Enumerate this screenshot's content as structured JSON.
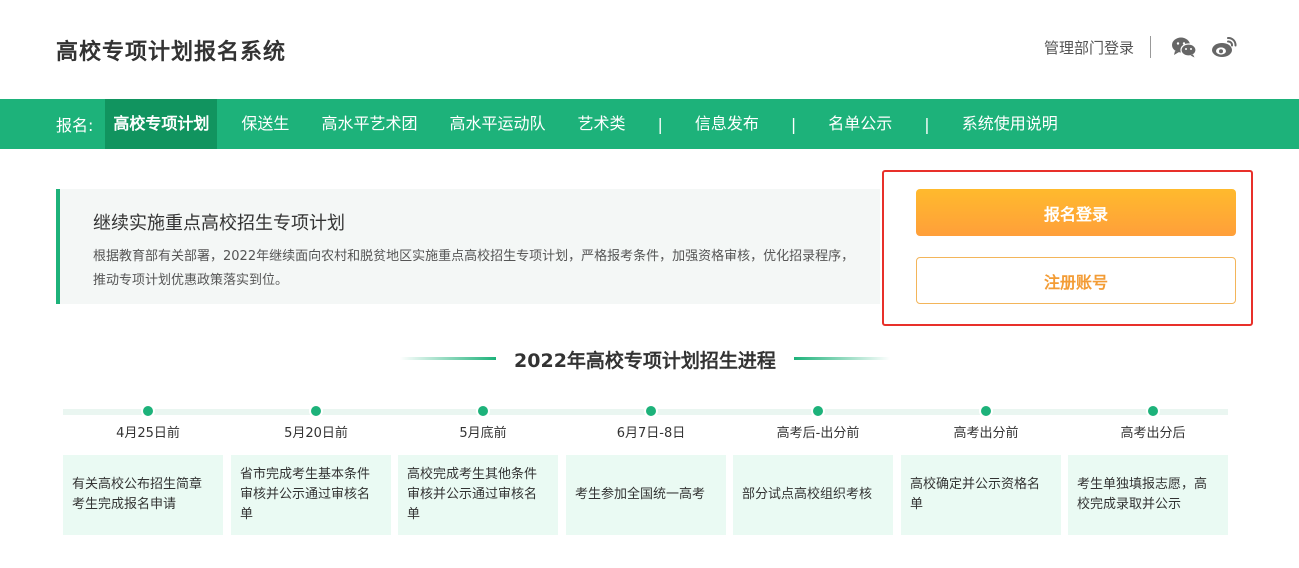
{
  "header": {
    "title": "高校专项计划报名系统",
    "admin_login": "管理部门登录",
    "icons": [
      "wechat-icon",
      "weibo-icon"
    ]
  },
  "nav": {
    "prefix": "报名:",
    "items": [
      "高校专项计划",
      "保送生",
      "高水平艺术团",
      "高水平运动队",
      "艺术类"
    ],
    "links": [
      "信息发布",
      "名单公示",
      "系统使用说明"
    ],
    "separator": "|",
    "active_index": 0
  },
  "intro": {
    "title": "继续实施重点高校招生专项计划",
    "text": "根据教育部有关部署，2022年继续面向农村和脱贫地区实施重点高校招生专项计划，严格报考条件，加强资格审核，优化招录程序，推动专项计划优惠政策落实到位。"
  },
  "auth": {
    "login_label": "报名登录",
    "register_label": "注册账号"
  },
  "progress": {
    "title": "2022年高校专项计划招生进程",
    "steps": [
      {
        "date": "4月25日前",
        "desc": "有关高校公布招生简章考生完成报名申请"
      },
      {
        "date": "5月20日前",
        "desc": "省市完成考生基本条件审核并公示通过审核名单"
      },
      {
        "date": "5月底前",
        "desc": "高校完成考生其他条件审核并公示通过审核名单"
      },
      {
        "date": "6月7日-8日",
        "desc": "考生参加全国统一高考"
      },
      {
        "date": "高考后-出分前",
        "desc": "部分试点高校组织考核"
      },
      {
        "date": "高考出分前",
        "desc": "高校确定并公示资格名单"
      },
      {
        "date": "高考出分后",
        "desc": "考生单独填报志愿，高校完成录取并公示"
      }
    ]
  },
  "colors": {
    "brand_green": "#1db27a",
    "nav_active": "#11945f",
    "login_orange": "#ffa834",
    "highlight_red": "#e8302a"
  }
}
